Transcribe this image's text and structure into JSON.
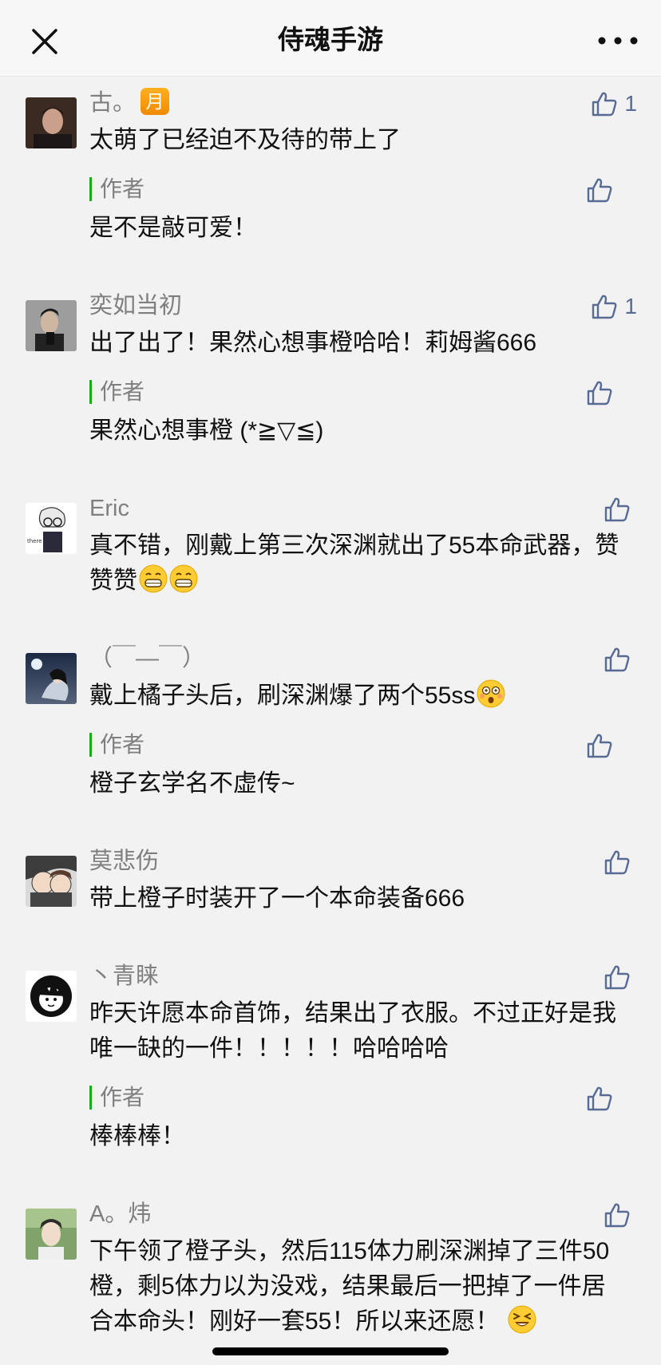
{
  "nav": {
    "title": "侍魂手游",
    "close_icon": "close-icon",
    "more_icon": "more-icon"
  },
  "colors": {
    "link_blue": "#576b95",
    "author_bar": "#1aad19",
    "badge_orange": "#f39a00"
  },
  "comments": [
    {
      "name": "古。",
      "badge": "月",
      "likes": "1",
      "text": "太萌了已经迫不及待的带上了",
      "reply": {
        "tag": "作者",
        "text": "是不是敲可爱！"
      }
    },
    {
      "name": "奕如当初",
      "likes": "1",
      "text": "出了出了！果然心想事橙哈哈！莉姆酱666",
      "reply": {
        "tag": "作者",
        "text": "果然心想事橙 (*≧▽≦)"
      }
    },
    {
      "name": "Eric",
      "likes": "",
      "text": "真不错，刚戴上第三次深渊就出了55本命武器，赞赞赞",
      "emojis": [
        "grin-emoji",
        "grin-emoji"
      ]
    },
    {
      "name": "（￣—￣）",
      "likes": "",
      "text": "戴上橘子头后，刷深渊爆了两个55ss",
      "emojis": [
        "dizzy-emoji"
      ],
      "reply": {
        "tag": "作者",
        "text": "橙子玄学名不虚传~"
      }
    },
    {
      "name": "莫悲伤",
      "likes": "",
      "text": "带上橙子时装开了一个本命装备666"
    },
    {
      "name": "丶青睐",
      "likes": "",
      "text": "昨天许愿本命首饰，结果出了衣服。不过正好是我唯一缺的一件！！！！！哈哈哈哈",
      "reply": {
        "tag": "作者",
        "text": "棒棒棒！"
      }
    },
    {
      "name": "A。炜",
      "likes": "",
      "text": "下午领了橙子头，然后115体力刷深渊掉了三件50橙，剩5体力以为没戏，结果最后一把掉了一件居合本命头！刚好一套55！所以来还愿！",
      "emojis": [
        "squint-laugh-emoji"
      ]
    }
  ]
}
